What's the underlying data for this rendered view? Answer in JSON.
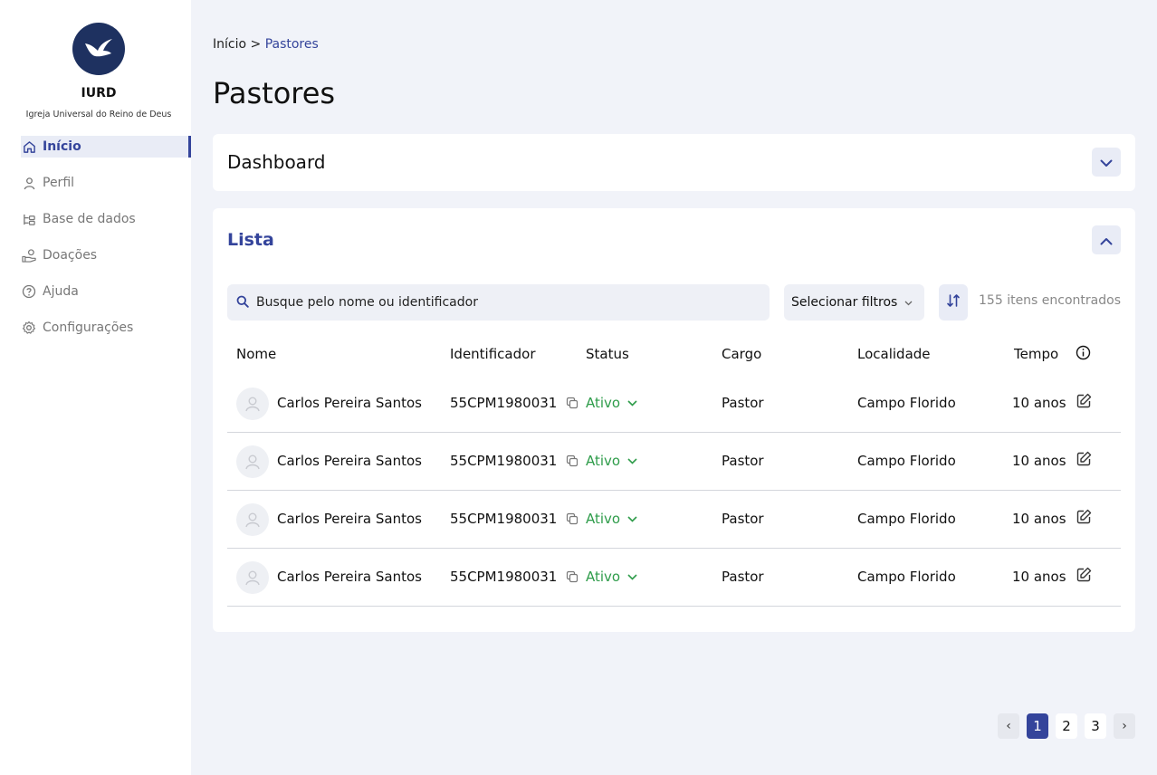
{
  "brand": {
    "name": "IURD",
    "subtitle": "Igreja Universal do Reino de Deus",
    "logo_icon": "dove-icon"
  },
  "sidebar": {
    "items": [
      {
        "label": "Início",
        "icon": "home-icon",
        "active": true
      },
      {
        "label": "Perfil",
        "icon": "user-icon",
        "active": false
      },
      {
        "label": "Base de dados",
        "icon": "database-icon",
        "active": false
      },
      {
        "label": "Doações",
        "icon": "donation-icon",
        "active": false
      },
      {
        "label": "Ajuda",
        "icon": "help-icon",
        "active": false
      },
      {
        "label": "Configurações",
        "icon": "gear-icon",
        "active": false
      }
    ]
  },
  "breadcrumb": {
    "home": "Início",
    "separator": ">",
    "current": "Pastores"
  },
  "page_title": "Pastores",
  "dashboard": {
    "title": "Dashboard",
    "expanded": false
  },
  "list": {
    "title": "Lista",
    "expanded": true,
    "search_placeholder": "Busque pelo nome ou identificador",
    "filter_label": "Selecionar filtros",
    "count_text": "155 itens encontrados",
    "columns": {
      "name": "Nome",
      "id": "Identificador",
      "status": "Status",
      "cargo": "Cargo",
      "locality": "Localidade",
      "tempo": "Tempo"
    },
    "rows": [
      {
        "name": "Carlos Pereira Santos",
        "id": "55CPM1980031",
        "status": "Ativo",
        "cargo": "Pastor",
        "locality": "Campo Florido",
        "tempo": "10 anos"
      },
      {
        "name": "Carlos Pereira Santos",
        "id": "55CPM1980031",
        "status": "Ativo",
        "cargo": "Pastor",
        "locality": "Campo Florido",
        "tempo": "10 anos"
      },
      {
        "name": "Carlos Pereira Santos",
        "id": "55CPM1980031",
        "status": "Ativo",
        "cargo": "Pastor",
        "locality": "Campo Florido",
        "tempo": "10 anos"
      },
      {
        "name": "Carlos Pereira Santos",
        "id": "55CPM1980031",
        "status": "Ativo",
        "cargo": "Pastor",
        "locality": "Campo Florido",
        "tempo": "10 anos"
      }
    ]
  },
  "pagination": {
    "prev": "‹",
    "next": "›",
    "pages": [
      "1",
      "2",
      "3"
    ],
    "current": "1"
  },
  "colors": {
    "accent": "#34449b",
    "status_active": "#2e9c4a",
    "logo_bg": "#1e3160",
    "background": "#f1f3f9"
  }
}
